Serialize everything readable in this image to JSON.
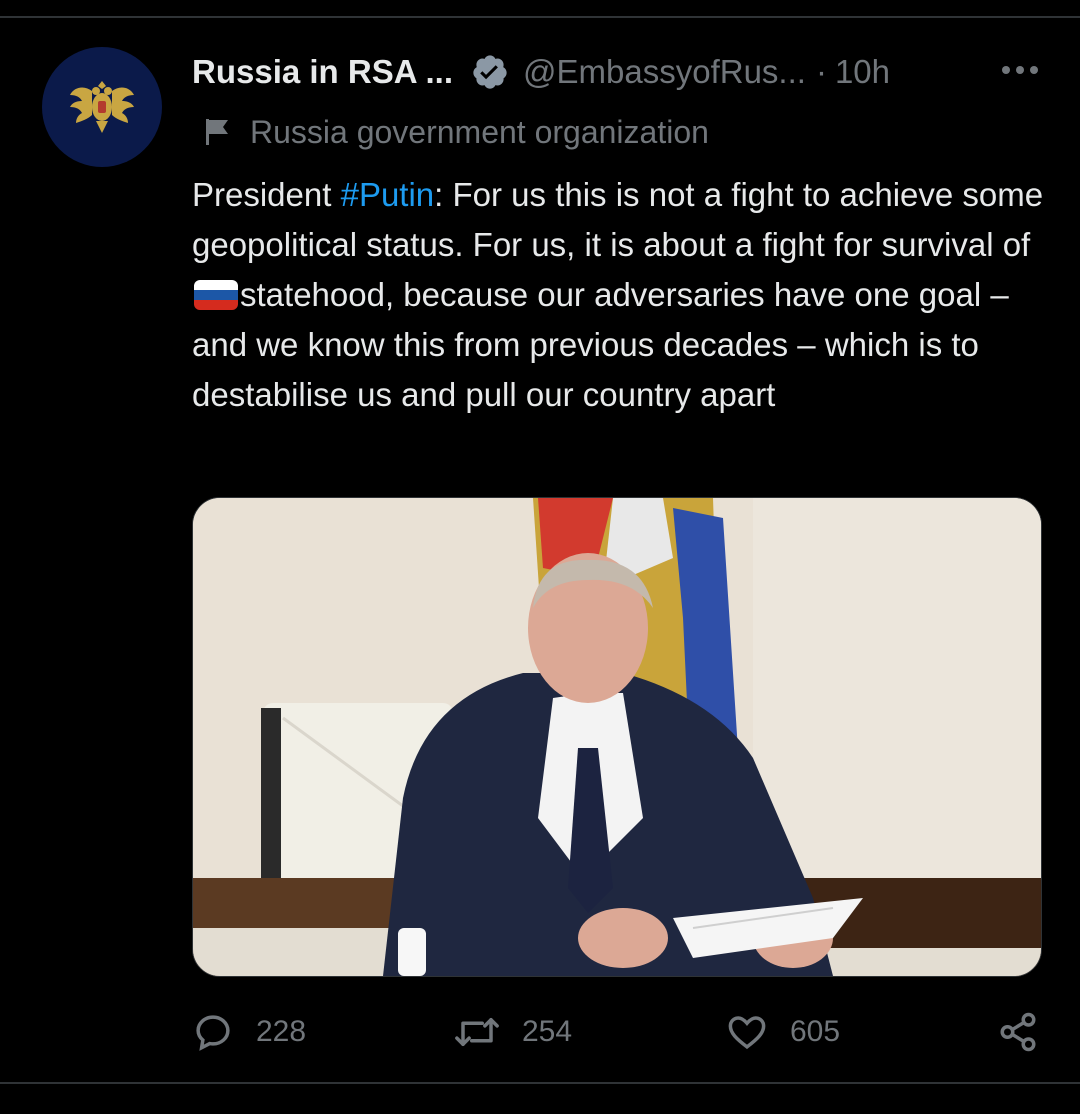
{
  "tweet": {
    "display_name": "Russia in RSA ...",
    "verified_badge_color": "#8b98a5",
    "handle": "@EmbassyofRus...",
    "separator": "·",
    "time": "10h",
    "affiliation": "Russia government organization",
    "text": {
      "part1": "President ",
      "hashtag": "#Putin",
      "part2": ": For us this is not a fight to achieve some geopolitical status. For us, it is about a fight for survival of",
      "emoji": "russia-flag-emoji",
      "part3": "statehood, because our adversaries have one goal – and we know this from previous decades – which is to destabilise us and pull our country apart"
    },
    "media": {
      "description_icon": "photo"
    },
    "actions": {
      "replies": "228",
      "retweets": "254",
      "likes": "605"
    },
    "icons": {
      "avatar": "double-headed-eagle-emblem",
      "more": "ellipsis-icon",
      "affiliation": "flag-icon",
      "reply": "comment-bubble-icon",
      "retweet": "retweet-arrows-icon",
      "like": "heart-icon",
      "share": "share-icon"
    },
    "colors": {
      "background": "#000000",
      "text": "#e7e9ea",
      "muted": "#71767b",
      "link": "#1d9bf0",
      "divider": "#2f3336"
    }
  }
}
